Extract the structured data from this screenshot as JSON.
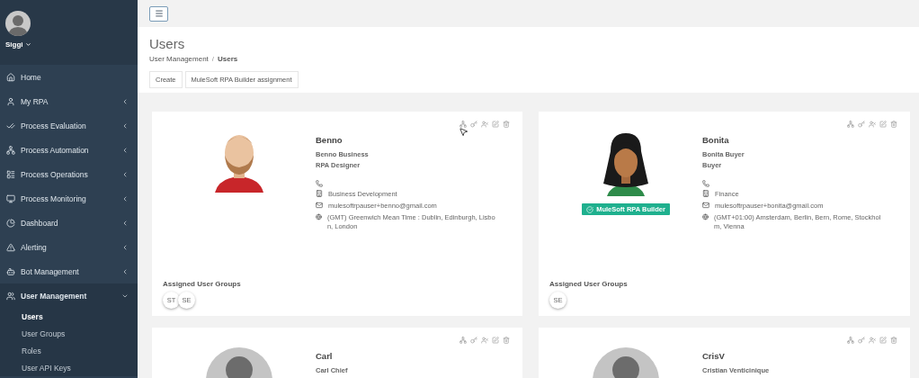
{
  "sidebar": {
    "user": {
      "name": "Siggi"
    },
    "items": [
      {
        "label": "Home",
        "has_submenu": false,
        "expanded": false
      },
      {
        "label": "My RPA",
        "has_submenu": true,
        "expanded": false
      },
      {
        "label": "Process Evaluation",
        "has_submenu": true,
        "expanded": false
      },
      {
        "label": "Process Automation",
        "has_submenu": true,
        "expanded": false
      },
      {
        "label": "Process Operations",
        "has_submenu": true,
        "expanded": false
      },
      {
        "label": "Process Monitoring",
        "has_submenu": true,
        "expanded": false
      },
      {
        "label": "Dashboard",
        "has_submenu": true,
        "expanded": false
      },
      {
        "label": "Alerting",
        "has_submenu": true,
        "expanded": false
      },
      {
        "label": "Bot Management",
        "has_submenu": true,
        "expanded": false
      },
      {
        "label": "User Management",
        "has_submenu": true,
        "expanded": true,
        "children": [
          {
            "label": "Users",
            "selected": true
          },
          {
            "label": "User Groups",
            "selected": false
          },
          {
            "label": "Roles",
            "selected": false
          },
          {
            "label": "User API Keys",
            "selected": false
          }
        ]
      }
    ]
  },
  "page": {
    "title": "Users",
    "breadcrumb": [
      "User Management",
      "Users"
    ],
    "breadcrumb_separator": "/",
    "buttons": [
      "Create",
      "MuleSoft RPA Builder assignment"
    ]
  },
  "users": [
    {
      "name": "Benno",
      "full_name": "Benno Business",
      "role": "RPA Designer",
      "details": [
        {
          "kind": "phone"
        },
        {
          "kind": "department",
          "text": "Business Development"
        },
        {
          "kind": "email",
          "text": "mulesoftrpauser+benno@gmail.com"
        },
        {
          "kind": "timezone",
          "text": "(GMT) Greenwich Mean Time : Dublin, Edinburgh, Lisbon, London"
        }
      ],
      "groups_title": "Assigned User Groups",
      "groups": [
        "ST",
        "SE"
      ]
    },
    {
      "name": "Bonita",
      "full_name": "Bonita Buyer",
      "role": "Buyer",
      "badge": "MuleSoft RPA Builder",
      "details": [
        {
          "kind": "phone"
        },
        {
          "kind": "department",
          "text": "Finance"
        },
        {
          "kind": "email",
          "text": "mulesoftrpauser+bonita@gmail.com"
        },
        {
          "kind": "timezone",
          "text": "(GMT+01:00) Amsterdam, Berlin, Bern, Rome, Stockholm, Vienna"
        }
      ],
      "groups_title": "Assigned User Groups",
      "groups": [
        "SE"
      ]
    },
    {
      "name": "Carl",
      "full_name": "Carl Chief"
    },
    {
      "name": "CrisV",
      "full_name": "Cristian Venticinique"
    }
  ]
}
